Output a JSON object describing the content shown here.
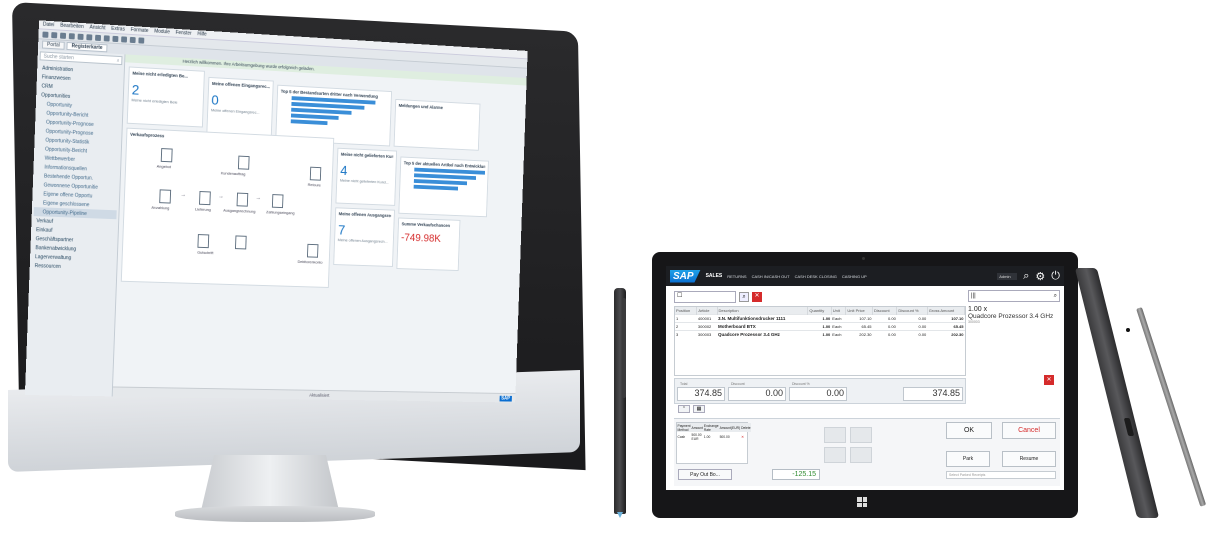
{
  "desktop": {
    "menu": [
      "Datei",
      "Bearbeiten",
      "Ansicht",
      "Extras",
      "Formate",
      "Module",
      "Fenster",
      "Hilfe"
    ],
    "tabs": [
      "Portal",
      "Registerkarte"
    ],
    "search_placeholder": "Suche starten",
    "nav": [
      {
        "label": "Administration",
        "sub": false
      },
      {
        "label": "Finanzwesen",
        "sub": false
      },
      {
        "label": "CRM",
        "sub": false
      },
      {
        "label": "Opportunities",
        "sub": false
      },
      {
        "label": "Opportunity",
        "sub": true
      },
      {
        "label": "Opportunity-Bericht",
        "sub": true
      },
      {
        "label": "Opportunity-Prognose",
        "sub": true
      },
      {
        "label": "Opportunity-Prognose",
        "sub": true
      },
      {
        "label": "Opportunity-Statistik",
        "sub": true
      },
      {
        "label": "Opportunity-Bericht",
        "sub": true
      },
      {
        "label": "Wettbewerber",
        "sub": true
      },
      {
        "label": "Informationsquellen",
        "sub": true
      },
      {
        "label": "Bestehende Opportun.",
        "sub": true
      },
      {
        "label": "Gewonnene Opportunitie",
        "sub": true
      },
      {
        "label": "Eigene offene Opportu",
        "sub": true
      },
      {
        "label": "Eigene geschlossene",
        "sub": true
      },
      {
        "label": "Opportunity-Pipeline",
        "sub": true,
        "selected": true
      },
      {
        "label": "Verkauf",
        "sub": false
      },
      {
        "label": "Einkauf",
        "sub": false
      },
      {
        "label": "Geschäftspartner",
        "sub": false
      },
      {
        "label": "Bankenabwicklung",
        "sub": false
      },
      {
        "label": "Lagerverwaltung",
        "sub": false
      },
      {
        "label": "Ressourcen",
        "sub": false
      }
    ],
    "notice": "Herzlich willkommen. Ihre Arbeitsumgebung wurde erfolgreich geladen.",
    "tiles": {
      "t1_title": "Meine nicht erledigten Be...",
      "t1_num": "2",
      "t1_sub": "Meine nicht erledigten Bele",
      "t2_title": "Meine offenen Eingangsrec...",
      "t2_num": "0",
      "t2_sub": "Meine offenen Eingangsrec...",
      "t3_title": "Top 5 der Bestandsarten dritter nach Verwendung",
      "t4_title": "Meine nicht gelieferten Kund...",
      "t4_num": "4",
      "t4_sub": "Meine nicht gelieferten Kund...",
      "t5_title": "Top 5 der aktuellen Artikel nach Entwicklung",
      "t6_title": "Meine offenen Ausgangsrech...",
      "t6_num": "7",
      "t6_sub": "Meine offenen Ausgangsrech...",
      "t7_title": "Summe Verkaufschancen",
      "t7_num": "-749.98K",
      "t8_title": "Meldungen und Alarme",
      "flow_title": "Verkaufsprozess"
    },
    "flow_labels": [
      "Angebot",
      "Kundenauftrag",
      "Lieferung",
      "Ausgangsrechnung",
      "Anzahlung",
      "Zahlungseingang",
      "Retoure",
      "Gutschrift",
      "Debitorenkonto"
    ],
    "status": "Aktualisiert"
  },
  "pos": {
    "brand": "SAP",
    "tabs": [
      "SALES",
      "RETURNS",
      "CASH IN/CASH OUT",
      "CASH DESK CLOSING",
      "CASHING UP"
    ],
    "user": "Admin",
    "grid_headers": [
      "Position",
      "Article",
      "Description",
      "Quantity",
      "Unit",
      "Unit Price",
      "Discount",
      "Discount %",
      "Gross Amount"
    ],
    "rows": [
      {
        "pos": "1",
        "article": "400001",
        "desc": "3.N. Multifunktionsdrucker 1111",
        "qty": "1.00",
        "unit": "Each",
        "price": "107.10",
        "disc": "0.00",
        "discp": "0.00",
        "amount": "107.10"
      },
      {
        "pos": "2",
        "article": "300002",
        "desc": "Motherboard BTX",
        "qty": "1.00",
        "unit": "Each",
        "price": "65.45",
        "disc": "0.00",
        "discp": "0.00",
        "amount": "65.45"
      },
      {
        "pos": "3",
        "article": "300003",
        "desc": "Quadcore Prozessor 3.4 GHz",
        "qty": "1.00",
        "unit": "Each",
        "price": "202.30",
        "disc": "0.00",
        "discp": "0.00",
        "amount": "202.30"
      }
    ],
    "totals": {
      "total_label": "Total",
      "total": "374.85",
      "discount_label": "Discount",
      "discount": "0.00",
      "discount_pct_label": "Discount %",
      "discount_pct": "0.00",
      "grand": "374.85"
    },
    "detail": {
      "qty": "1.00 x",
      "product": "Quadcore Prozessor 3.4 GHz",
      "sku": "300003"
    },
    "pay_headers": [
      "Payment Method",
      "Amount",
      "Exchange Rate",
      "Amount(EUR)",
      "Delete"
    ],
    "pay_row": {
      "method": "Cash",
      "amount": "500.00 EUR",
      "rate": "1.00",
      "eur": "500.00"
    },
    "pay_out": "Pay Out Bo...",
    "change": "-125.15",
    "ok": "OK",
    "cancel": "Cancel",
    "park": "Park",
    "resume": "Resume",
    "reason": "Select Parked Receipts"
  },
  "colors": {
    "accent_blue": "#1874c4",
    "sap_blue": "#0a6ed1",
    "cancel_red": "#d52b2b",
    "change_green": "#2e8b2e"
  }
}
